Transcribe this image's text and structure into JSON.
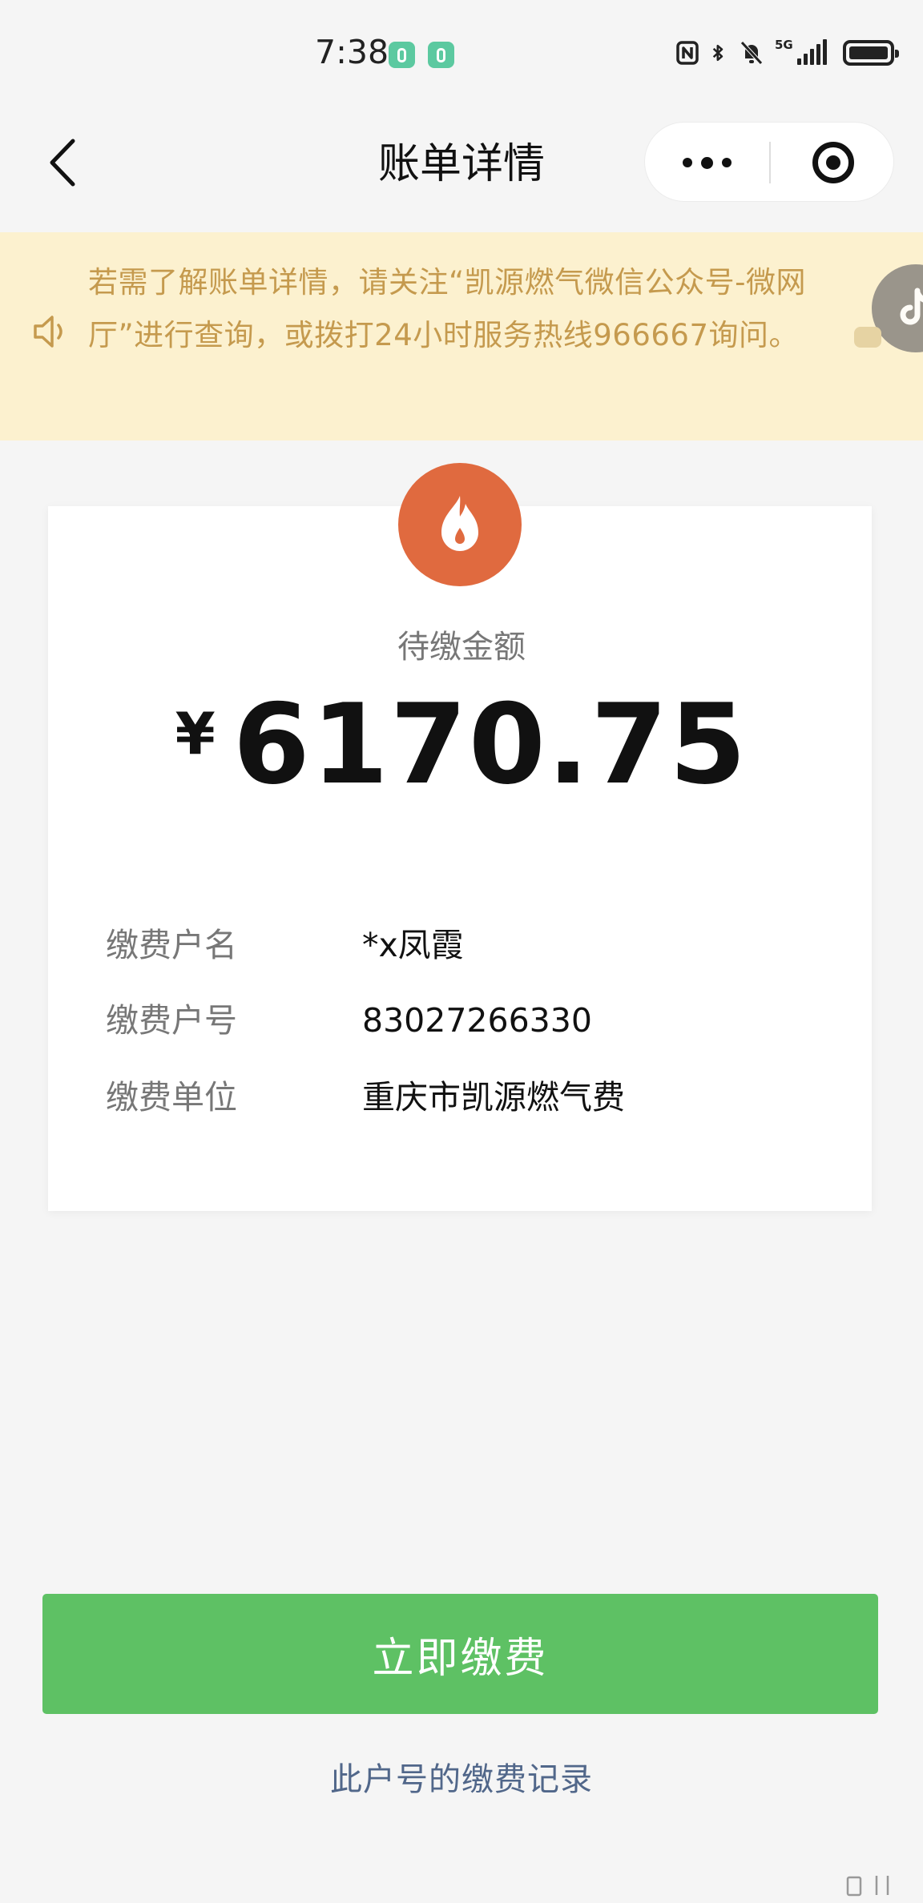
{
  "status_bar": {
    "time": "7:38",
    "network": "5G"
  },
  "nav": {
    "title": "账单详情"
  },
  "notice": {
    "text": "若需了解账单详情，请关注“凯源燃气微信公众号-微网厅”进行查询，或拨打24小时服务热线966667询问。"
  },
  "bill": {
    "amount_label": "待缴金额",
    "currency": "¥",
    "amount": "6170.75",
    "fields": [
      {
        "label": "缴费户名",
        "value": "*x凤霞"
      },
      {
        "label": "缴费户号",
        "value": "83027266330"
      },
      {
        "label": "缴费单位",
        "value": "重庆市凯源燃气费"
      }
    ]
  },
  "actions": {
    "pay_label": "立即缴费",
    "records_label": "此户号的缴费记录"
  },
  "colors": {
    "accent_green": "#5ec164",
    "notice_bg": "#fcf1cf",
    "notice_text": "#c59a4e",
    "flame_badge": "#e06a3f",
    "link": "#51678a"
  },
  "icons": {
    "back": "chevron-left-icon",
    "more": "more-dots-icon",
    "close": "target-circle-icon",
    "notice": "speaker-icon",
    "badge": "flame-icon"
  }
}
